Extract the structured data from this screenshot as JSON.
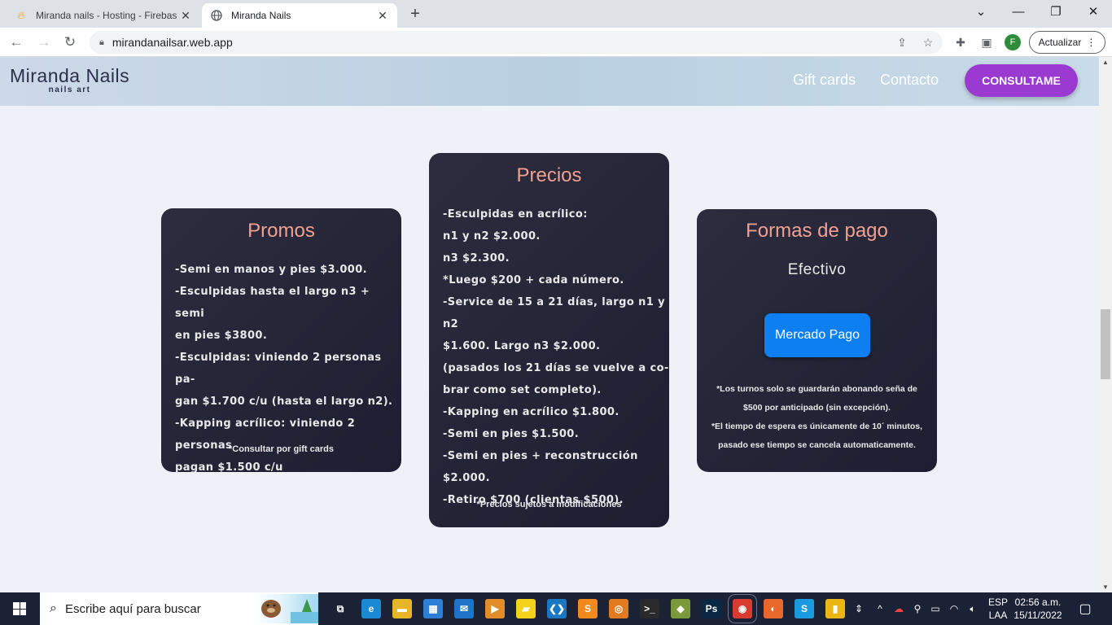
{
  "browser": {
    "tabs": [
      {
        "title": "Miranda nails - Hosting - Firebas",
        "icon": "firebase-icon",
        "active": false
      },
      {
        "title": "Miranda Nails",
        "icon": "globe-icon",
        "active": true
      }
    ],
    "address": "mirandanailsar.web.app",
    "update_label": "Actualizar",
    "profile_initial": "F"
  },
  "site": {
    "logo": {
      "name": "Miranda Nails",
      "tagline": "nails art"
    },
    "nav": {
      "gift_cards": "Gift cards",
      "contacto": "Contacto",
      "cta": "CONSULTAME"
    },
    "promos": {
      "title": "Promos",
      "lines": [
        "-Semi en manos y pies $3.000.",
        "-Esculpidas hasta el largo n3 + semi",
        "en pies $3800.",
        "-Esculpidas: viniendo 2 personas pa-",
        "gan $1.700 c/u (hasta el largo n2).",
        "-Kapping acrílico: viniendo 2 personas",
        "pagan $1.500 c/u"
      ],
      "note": "*Consultar por gift cards"
    },
    "precios": {
      "title": "Precios",
      "lines": [
        "-Esculpidas en acrílico:",
        "n1 y n2 $2.000.",
        "n3 $2.300.",
        "*Luego $200 + cada número.",
        "-Service de 15 a 21 días, largo n1 y n2",
        "$1.600. Largo n3 $2.000.",
        "(pasados los 21 días se vuelve a co-",
        "brar como set completo).",
        "-Kapping en acrílico $1.800.",
        "-Semi en pies $1.500.",
        "-Semi en pies + reconstrucción $2.000.",
        "-Retiro $700 (clientas $500)."
      ],
      "note": "*Precios sujetos a modificaciones"
    },
    "pago": {
      "title": "Formas de pago",
      "efectivo": "Efectivo",
      "mercado_pago": "Mercado Pago",
      "notes": [
        "*Los turnos solo se guardarán abonando seña de",
        "$500 por anticipado (sin excepción).",
        "*El tiempo de espera es únicamente de 10´ minutos,",
        "pasado ese tiempo se cancela automaticamente."
      ]
    }
  },
  "taskbar": {
    "search_placeholder": "Escribe aquí para buscar",
    "lang": [
      "ESP",
      "LAA"
    ],
    "time": "02:56 a.m.",
    "date": "15/11/2022",
    "apps": [
      {
        "name": "task-view-icon",
        "glyph": "⧉",
        "color": "#1c2236"
      },
      {
        "name": "edge-icon",
        "glyph": "e",
        "color": "#1a8ad4"
      },
      {
        "name": "file-explorer-icon",
        "glyph": "▬",
        "color": "#e8b428"
      },
      {
        "name": "store-icon",
        "glyph": "▦",
        "color": "#2d7fd6"
      },
      {
        "name": "mail-icon",
        "glyph": "✉",
        "color": "#1e73c9"
      },
      {
        "name": "media-player-icon",
        "glyph": "▶",
        "color": "#e28d2a"
      },
      {
        "name": "sticky-notes-icon",
        "glyph": "▰",
        "color": "#f2d21b"
      },
      {
        "name": "vscode-icon",
        "glyph": "❮❯",
        "color": "#1a78c2"
      },
      {
        "name": "sublime-icon",
        "glyph": "S",
        "color": "#f08a1c"
      },
      {
        "name": "jupyter-icon",
        "glyph": "◎",
        "color": "#e07b20"
      },
      {
        "name": "terminal-icon",
        "glyph": ">_",
        "color": "#2a2a2a"
      },
      {
        "name": "git-icon",
        "glyph": "◆",
        "color": "#7a9a3a"
      },
      {
        "name": "photoshop-icon",
        "glyph": "Ps",
        "color": "#0a2744"
      },
      {
        "name": "chrome-icon",
        "glyph": "◉",
        "color": "#d93b30"
      },
      {
        "name": "firefox-icon",
        "glyph": "◐",
        "color": "#e8672a"
      },
      {
        "name": "skype-icon",
        "glyph": "S",
        "color": "#1a9ae0"
      },
      {
        "name": "powerbi-icon",
        "glyph": "▮",
        "color": "#e9b614"
      }
    ]
  }
}
